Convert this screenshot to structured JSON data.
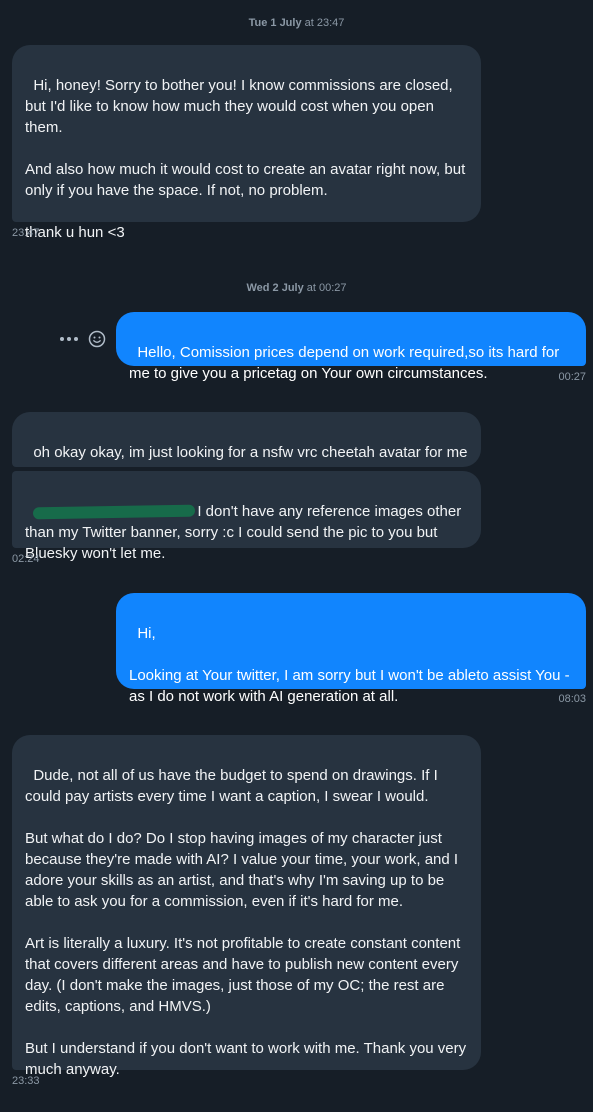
{
  "colors": {
    "background": "#161e27",
    "incoming_bubble": "#273340",
    "outgoing_bubble": "#1185fe",
    "meta_text": "#8b98a5",
    "redaction": "#176b4a"
  },
  "separators": [
    {
      "day": "Tue 1 July",
      "time": " at 23:47"
    },
    {
      "day": "Wed 2 July",
      "time": " at 00:27"
    }
  ],
  "messages": [
    {
      "direction": "in",
      "text": "Hi, honey! Sorry to bother you! I know commissions are closed, but I'd like to know how much they would cost when you open them.\n\nAnd also how much it would cost to create an avatar right now, but only if you have the space. If not, no problem.\n\nthank u hun <3",
      "time": "23:47"
    },
    {
      "direction": "out",
      "text": "Hello, Comission prices depend on work required,so its hard for me to give you a pricetag on Your own circumstances.",
      "time": "00:27"
    },
    {
      "direction": "in",
      "text": "oh okay okay, im just looking for a nsfw vrc cheetah avatar for me",
      "time": ""
    },
    {
      "direction": "in",
      "text": "I don't have any reference images other than my Twitter banner, sorry :c I could send the pic to you but Bluesky won't let me.",
      "time": "02:24"
    },
    {
      "direction": "out",
      "text": "Hi,\n\nLooking at Your twitter, I am sorry but I won't be ableto assist You - as I do not work with AI generation at all.",
      "time": "08:03"
    },
    {
      "direction": "in",
      "text": "Dude, not all of us have the budget to spend on drawings. If I could pay artists every time I want a caption, I swear I would.\n\nBut what do I do? Do I stop having images of my character just because they're made with AI? I value your time, your work, and I adore your skills as an artist, and that's why I'm saving up to be able to ask you for a commission, even if it's hard for me.\n\nArt is literally a luxury. It's not profitable to create constant content that covers different areas and have to publish new content every day. (I don't make the images, just those of my OC; the rest are edits, captions, and HMVS.)\n\nBut I understand if you don't want to work with me. Thank you very much anyway.",
      "time": "23:33"
    }
  ],
  "icons": {
    "more": "more-options-icon",
    "emoji": "emoji-reaction-icon"
  }
}
